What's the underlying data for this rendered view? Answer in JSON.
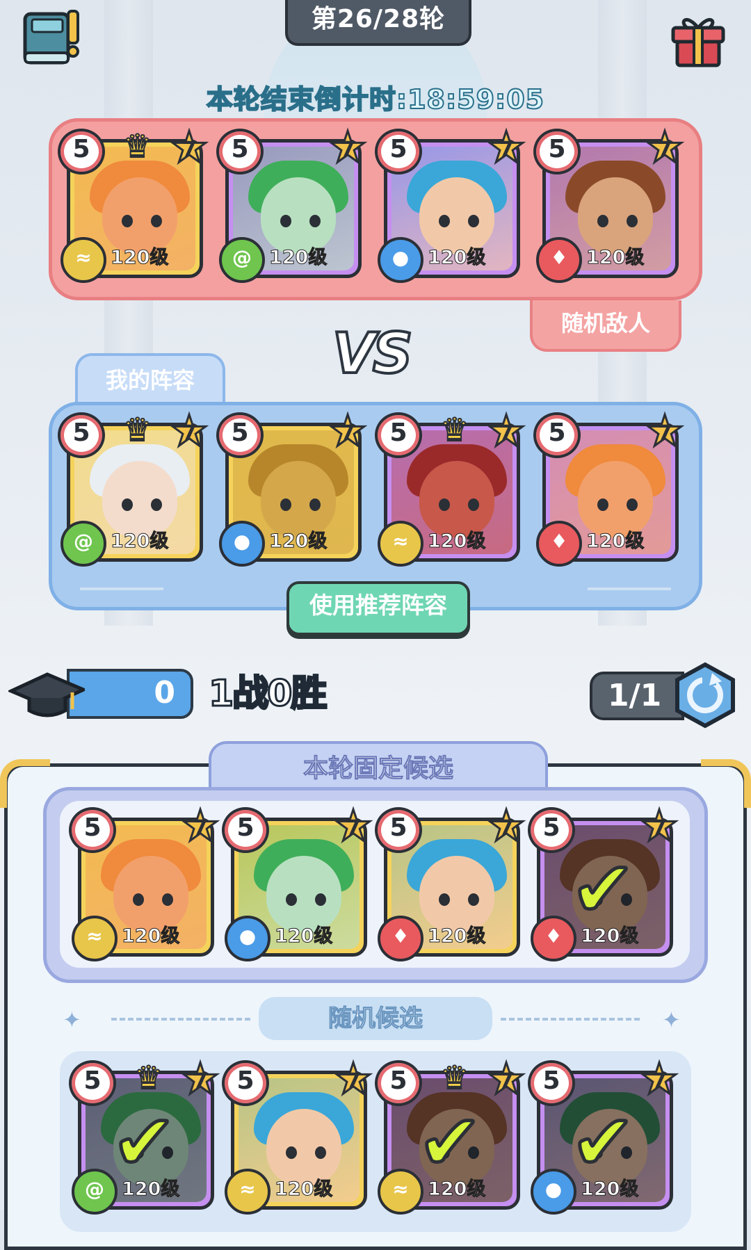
{
  "header": {
    "round": "第26/28轮",
    "countdown": "本轮结束倒计时:18:59:05"
  },
  "battle": {
    "enemy_tag": "随机敌人",
    "vs": "VS",
    "my_tag": "我的阵容",
    "recommend_button": "使用推荐阵容"
  },
  "stats": {
    "exp_value": "0",
    "record": "1战0胜",
    "refresh_count": "1/1"
  },
  "candidates": {
    "fixed_title": "本轮固定候选",
    "random_title": "随机候选"
  },
  "enemy_heroes": [
    {
      "rank": "5",
      "star": "7",
      "level": "120级",
      "element": "earth",
      "frame": "gold",
      "crown": true
    },
    {
      "rank": "5",
      "star": "7",
      "level": "120级",
      "element": "wind",
      "frame": "purple",
      "crown": false
    },
    {
      "rank": "5",
      "star": "7",
      "level": "120级",
      "element": "water",
      "frame": "purple",
      "crown": false
    },
    {
      "rank": "5",
      "star": "7",
      "level": "120级",
      "element": "fire",
      "frame": "purple",
      "crown": false
    }
  ],
  "my_heroes": [
    {
      "rank": "5",
      "star": "7",
      "level": "120级",
      "element": "wind",
      "frame": "gold",
      "crown": true
    },
    {
      "rank": "5",
      "star": "7",
      "level": "120级",
      "element": "water",
      "frame": "gold",
      "crown": false
    },
    {
      "rank": "5",
      "star": "7",
      "level": "120级",
      "element": "earth",
      "frame": "purple",
      "crown": true
    },
    {
      "rank": "5",
      "star": "7",
      "level": "120级",
      "element": "fire",
      "frame": "purple",
      "crown": false
    }
  ],
  "fixed_heroes": [
    {
      "rank": "5",
      "star": "7",
      "level": "120级",
      "element": "earth",
      "frame": "gold",
      "crown": false,
      "selected": false
    },
    {
      "rank": "5",
      "star": "7",
      "level": "120级",
      "element": "water",
      "frame": "gold",
      "crown": false,
      "selected": false
    },
    {
      "rank": "5",
      "star": "7",
      "level": "120级",
      "element": "fire",
      "frame": "gold",
      "crown": false,
      "selected": false
    },
    {
      "rank": "5",
      "star": "7",
      "level": "120级",
      "element": "fire",
      "frame": "purple",
      "crown": false,
      "selected": true
    }
  ],
  "random_heroes": [
    {
      "rank": "5",
      "star": "7",
      "level": "120级",
      "element": "wind",
      "frame": "purple",
      "crown": true,
      "selected": true
    },
    {
      "rank": "5",
      "star": "7",
      "level": "120级",
      "element": "earth",
      "frame": "gold",
      "crown": false,
      "selected": false
    },
    {
      "rank": "5",
      "star": "7",
      "level": "120级",
      "element": "earth",
      "frame": "purple",
      "crown": true,
      "selected": true
    },
    {
      "rank": "5",
      "star": "7",
      "level": "120级",
      "element": "water",
      "frame": "purple",
      "crown": false,
      "selected": true
    }
  ],
  "icons": {
    "book": "book-icon",
    "gift": "gift-icon",
    "hat": "graduation-cap-icon",
    "refresh": "refresh-icon",
    "crown": "crown-icon",
    "check": "check-icon"
  },
  "colors": {
    "enemy_panel": "#f4a0a0",
    "my_panel": "#a9cbf0",
    "recommend_button": "#6fd6b3",
    "exp_bar": "#5aa6e8"
  }
}
